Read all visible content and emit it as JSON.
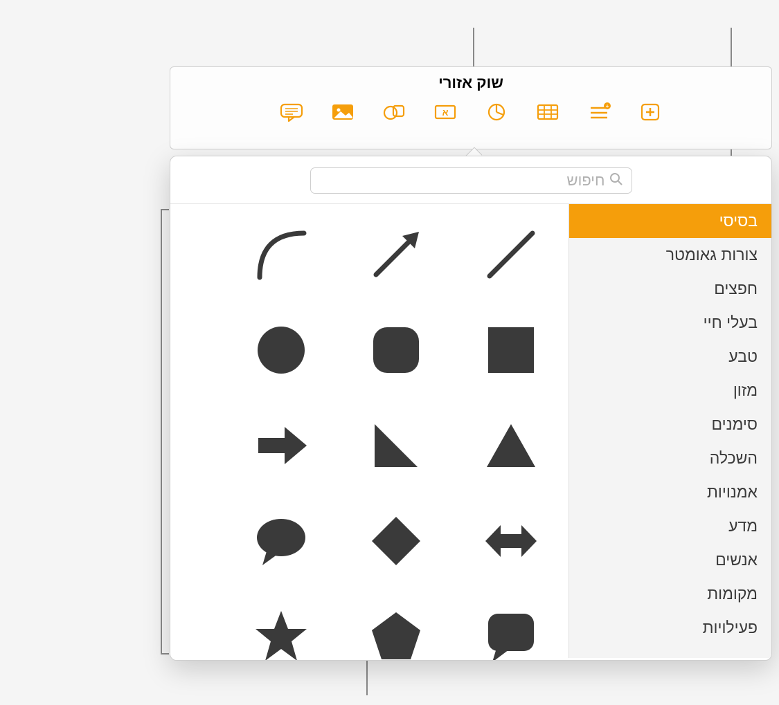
{
  "title": "שוק אזורי",
  "toolbar": {
    "items": [
      "comment",
      "image",
      "shapes",
      "text-box",
      "chart",
      "table",
      "format",
      "add"
    ]
  },
  "search": {
    "placeholder": "חיפוש"
  },
  "sidebar": {
    "items": [
      {
        "label": "בסיסי",
        "selected": true
      },
      {
        "label": "צורות גאומטר",
        "selected": false
      },
      {
        "label": "חפצים",
        "selected": false
      },
      {
        "label": "בעלי חיי",
        "selected": false
      },
      {
        "label": "טבע",
        "selected": false
      },
      {
        "label": "מזון",
        "selected": false
      },
      {
        "label": "סימנים",
        "selected": false
      },
      {
        "label": "השכלה",
        "selected": false
      },
      {
        "label": "אמנויות",
        "selected": false
      },
      {
        "label": "מדע",
        "selected": false
      },
      {
        "label": "אנשים",
        "selected": false
      },
      {
        "label": "מקומות",
        "selected": false
      },
      {
        "label": "פעילויות",
        "selected": false
      }
    ]
  },
  "shapes": [
    [
      "line",
      "arrow-line",
      "curve"
    ],
    [
      "square",
      "rounded-square",
      "circle"
    ],
    [
      "triangle",
      "right-triangle",
      "right-arrow"
    ],
    [
      "double-arrow",
      "diamond",
      "speech-bubble-oval"
    ],
    [
      "speech-bubble-rect",
      "pentagon",
      "star"
    ]
  ]
}
